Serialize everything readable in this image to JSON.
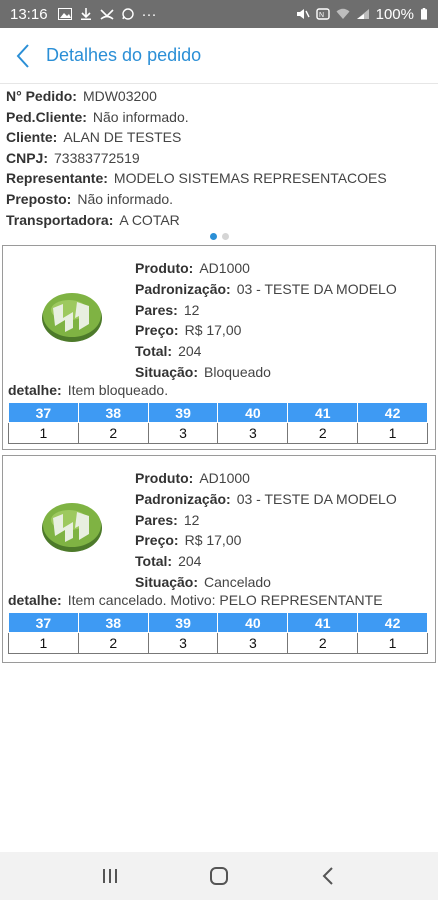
{
  "status_bar": {
    "time": "13:16",
    "more": "···",
    "battery": "100%"
  },
  "header": {
    "title": "Detalhes do pedido"
  },
  "order_info": [
    {
      "label": "N° Pedido:",
      "value": "MDW03200"
    },
    {
      "label": "Ped.Cliente:",
      "value": "Não informado."
    },
    {
      "label": "Cliente:",
      "value": "ALAN DE TESTES"
    },
    {
      "label": "CNPJ:",
      "value": "73383772519"
    },
    {
      "label": "Representante:",
      "value": "MODELO SISTEMAS REPRESENTACOES"
    },
    {
      "label": "Preposto:",
      "value": "Não informado."
    },
    {
      "label": "Transportadora:",
      "value": "A COTAR"
    }
  ],
  "items": [
    {
      "produto_label": "Produto:",
      "produto": "AD1000",
      "padronizacao_label": "Padronização:",
      "padronizacao": "03 - TESTE DA MODELO",
      "pares_label": "Pares:",
      "pares": "12",
      "preco_label": "Preço:",
      "preco": "R$ 17,00",
      "total_label": "Total:",
      "total": "204",
      "situacao_label": "Situação:",
      "situacao": "Bloqueado",
      "detalhe_label": "detalhe:",
      "detalhe": "Item bloqueado.",
      "sizes": [
        "37",
        "38",
        "39",
        "40",
        "41",
        "42"
      ],
      "quantities": [
        "1",
        "2",
        "3",
        "3",
        "2",
        "1"
      ]
    },
    {
      "produto_label": "Produto:",
      "produto": "AD1000",
      "padronizacao_label": "Padronização:",
      "padronizacao": "03 - TESTE DA MODELO",
      "pares_label": "Pares:",
      "pares": "12",
      "preco_label": "Preço:",
      "preco": "R$ 17,00",
      "total_label": "Total:",
      "total": "204",
      "situacao_label": "Situação:",
      "situacao": "Cancelado",
      "detalhe_label": "detalhe:",
      "detalhe": "Item cancelado. Motivo: PELO REPRESENTANTE",
      "sizes": [
        "37",
        "38",
        "39",
        "40",
        "41",
        "42"
      ],
      "quantities": [
        "1",
        "2",
        "3",
        "3",
        "2",
        "1"
      ]
    }
  ],
  "colors": {
    "accent": "#2b8fd6",
    "grid_header": "#3e9af3",
    "status_bar": "#6e6e6e"
  }
}
